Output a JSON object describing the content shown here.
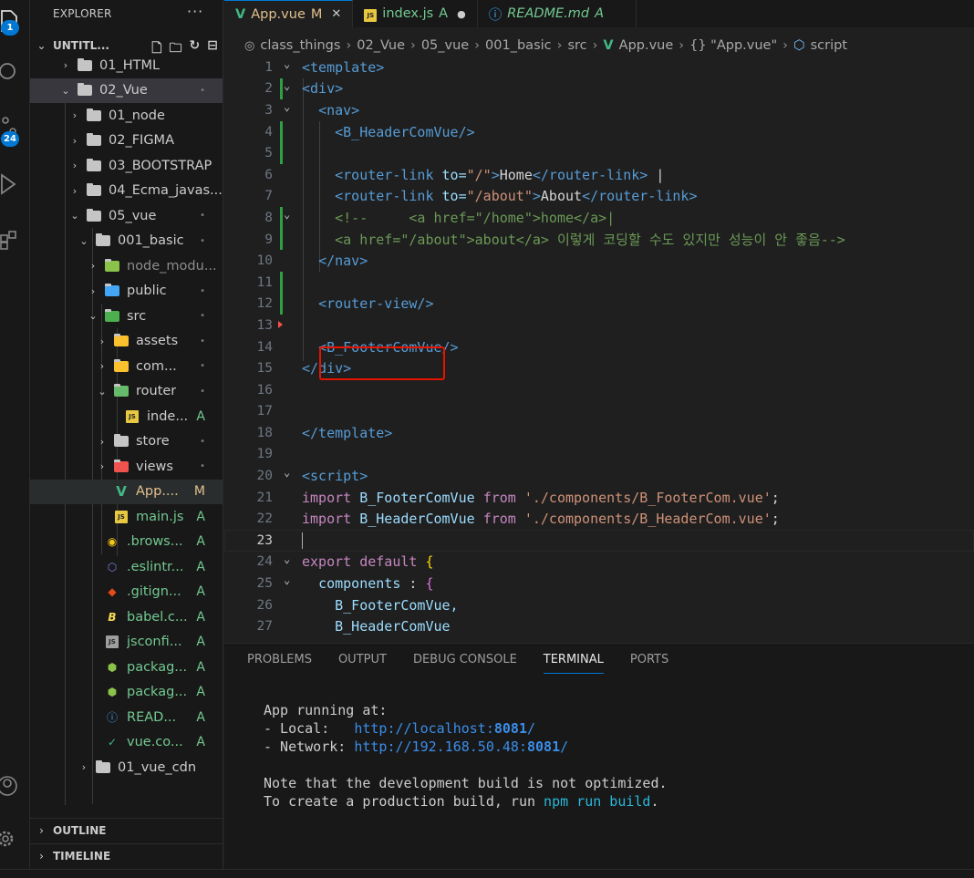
{
  "activity": {
    "explorer_badge": "1",
    "scm_badge": "24"
  },
  "sidebar": {
    "title": "EXPLORER",
    "workspace": "UNTITL...",
    "outline": "OUTLINE",
    "timeline": "TIMELINE",
    "tree": [
      {
        "name": "01_HTML",
        "status": ""
      },
      {
        "name": "02_Vue",
        "status": "•"
      },
      {
        "name": "01_node",
        "status": ""
      },
      {
        "name": "02_FIGMA",
        "status": ""
      },
      {
        "name": "03_BOOTSTRAP",
        "status": ""
      },
      {
        "name": "04_Ecma_javas...",
        "status": ""
      },
      {
        "name": "05_vue",
        "status": "•"
      },
      {
        "name": "001_basic",
        "status": "•"
      },
      {
        "name": "node_modu...",
        "status": ""
      },
      {
        "name": "public",
        "status": "•"
      },
      {
        "name": "src",
        "status": "•"
      },
      {
        "name": "assets",
        "status": "•"
      },
      {
        "name": "com...",
        "status": "•"
      },
      {
        "name": "router",
        "status": "•"
      },
      {
        "name": "inde...",
        "status": "A"
      },
      {
        "name": "store",
        "status": "•"
      },
      {
        "name": "views",
        "status": "•"
      },
      {
        "name": "App....",
        "status": "M"
      },
      {
        "name": "main.js",
        "status": "A"
      },
      {
        "name": ".brows...",
        "status": "A"
      },
      {
        "name": ".eslintr...",
        "status": "A"
      },
      {
        "name": ".gitign...",
        "status": "A"
      },
      {
        "name": "babel.c...",
        "status": "A"
      },
      {
        "name": "jsconfi...",
        "status": "A"
      },
      {
        "name": "packag...",
        "status": "A"
      },
      {
        "name": "packag...",
        "status": "A"
      },
      {
        "name": "READ...",
        "status": "A"
      },
      {
        "name": "vue.co...",
        "status": "A"
      },
      {
        "name": "01_vue_cdn",
        "status": ""
      }
    ]
  },
  "tabs": [
    {
      "label": "App.vue",
      "flag": "M"
    },
    {
      "label": "index.js",
      "flag": "A"
    },
    {
      "label": "README.md",
      "flag": "A"
    }
  ],
  "breadcrumbs": [
    "class_things",
    "02_Vue",
    "05_vue",
    "001_basic",
    "src",
    "App.vue",
    "{} \"App.vue\"",
    "script"
  ],
  "code": {
    "line_numbers": [
      "1",
      "2",
      "3",
      "4",
      "5",
      "6",
      "7",
      "8",
      "9",
      "10",
      "11",
      "12",
      "13",
      "14",
      "15",
      "16",
      "17",
      "18",
      "19",
      "20",
      "21",
      "22",
      "23",
      "24",
      "25",
      "26",
      "27"
    ],
    "l1": "<template>",
    "l2": "<div>",
    "l3": "<nav>",
    "l4": "<B_HeaderComVue/>",
    "l6_open": "<router-link",
    "l6_attr": " to=",
    "l6_val": "\"/\"",
    "l6_text": "Home",
    "l6_close": "</router-link>",
    "l6_cursor": " |",
    "l7_open": "<router-link",
    "l7_attr": " to=",
    "l7_val": "\"/about\"",
    "l7_text": "About",
    "l7_close": "</router-link>",
    "l8": "<!--     <a href=\"/home\">home</a>|",
    "l9": "<a href=\"/about\">about</a> 이렇게 코딩할 수도 있지만 성능이 안 좋음-->",
    "l10": "</nav>",
    "l12": "<router-view/>",
    "l14": "<B_FooterComVue/>",
    "l15": "</div>",
    "l18": "</template>",
    "l20": "<script>",
    "l21_kw": "import",
    "l21_name": " B_FooterComVue ",
    "l21_from": "from",
    "l21_str": " './components/B_FooterCom.vue'",
    "l21_end": ";",
    "l22_kw": "import",
    "l22_name": " B_HeaderComVue ",
    "l22_from": "from",
    "l22_str": " './components/B_HeaderCom.vue'",
    "l22_end": ";",
    "l24_kw": "export default ",
    "l24_br": "{",
    "l25_key": "components",
    "l25_sep": " : ",
    "l25_br": "{",
    "l26": "B_FooterComVue,",
    "l27": "B_HeaderComVue"
  },
  "panel": {
    "tabs": [
      "PROBLEMS",
      "OUTPUT",
      "DEBUG CONSOLE",
      "TERMINAL",
      "PORTS"
    ],
    "active_tab": "TERMINAL",
    "t1": "App running at:",
    "t2_label": "- Local:   ",
    "t2_link": "http://localhost:",
    "t2_port": "8081",
    "t2_slash": "/",
    "t3_label": "- Network: ",
    "t3_link": "http://192.168.50.48:",
    "t3_port": "8081",
    "t3_slash": "/",
    "t5": "Note that the development build is not optimized.",
    "t6_a": "To create a production build, run ",
    "t6_cmd": "npm run build",
    "t6_b": "."
  },
  "colors": {
    "accent": "#0078d4",
    "modified": "#e2c08d",
    "added": "#73c991",
    "highlight_box": "#e51400"
  }
}
